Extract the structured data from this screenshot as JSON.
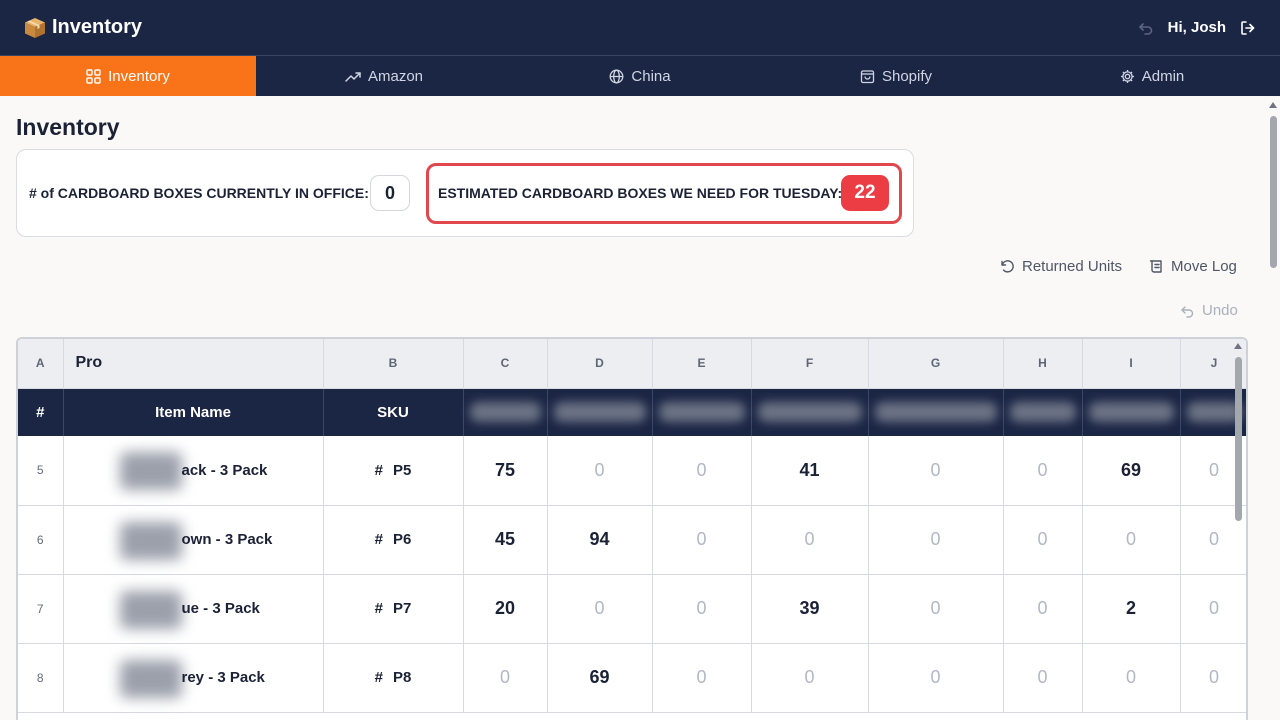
{
  "app": {
    "title": "Inventory",
    "greeting": "Hi, Josh"
  },
  "nav": {
    "tabs": [
      {
        "label": "Inventory",
        "icon": "grid-icon",
        "active": true
      },
      {
        "label": "Amazon",
        "icon": "trending-icon"
      },
      {
        "label": "China",
        "icon": "globe-icon"
      },
      {
        "label": "Shopify",
        "icon": "shopping-bag-icon"
      },
      {
        "label": "Admin",
        "icon": "gear-icon"
      }
    ]
  },
  "page": {
    "title": "Inventory"
  },
  "boxes": {
    "current_label": "# of CARDBOARD BOXES CURRENTLY IN OFFICE:",
    "current_value": "0",
    "estimated_label": "ESTIMATED CARDBOARD BOXES WE NEED FOR TUESDAY:",
    "estimated_value": "22"
  },
  "actions": {
    "returned_units": "Returned Units",
    "move_log": "Move Log",
    "undo": "Undo"
  },
  "table": {
    "letters": [
      "A",
      "Pro",
      "B",
      "C",
      "D",
      "E",
      "F",
      "G",
      "H",
      "I",
      "J"
    ],
    "headers": {
      "num": "#",
      "item_name": "Item Name",
      "sku": "SKU"
    },
    "sku_prefix": "#",
    "rows": [
      {
        "num": "5",
        "name": "ack - 3 Pack",
        "sku": "P5",
        "values": [
          "75",
          "0",
          "0",
          "41",
          "0",
          "0",
          "69",
          "0"
        ]
      },
      {
        "num": "6",
        "name": "own - 3 Pack",
        "sku": "P6",
        "values": [
          "45",
          "94",
          "0",
          "0",
          "0",
          "0",
          "0",
          "0"
        ]
      },
      {
        "num": "7",
        "name": "ue - 3 Pack",
        "sku": "P7",
        "values": [
          "20",
          "0",
          "0",
          "39",
          "0",
          "0",
          "2",
          "0"
        ]
      },
      {
        "num": "8",
        "name": "rey - 3 Pack",
        "sku": "P8",
        "values": [
          "0",
          "69",
          "0",
          "0",
          "0",
          "0",
          "0",
          "0"
        ]
      }
    ]
  },
  "colors": {
    "navy": "#1b2645",
    "accent": "#f97418",
    "alert": "#ec3d44"
  }
}
